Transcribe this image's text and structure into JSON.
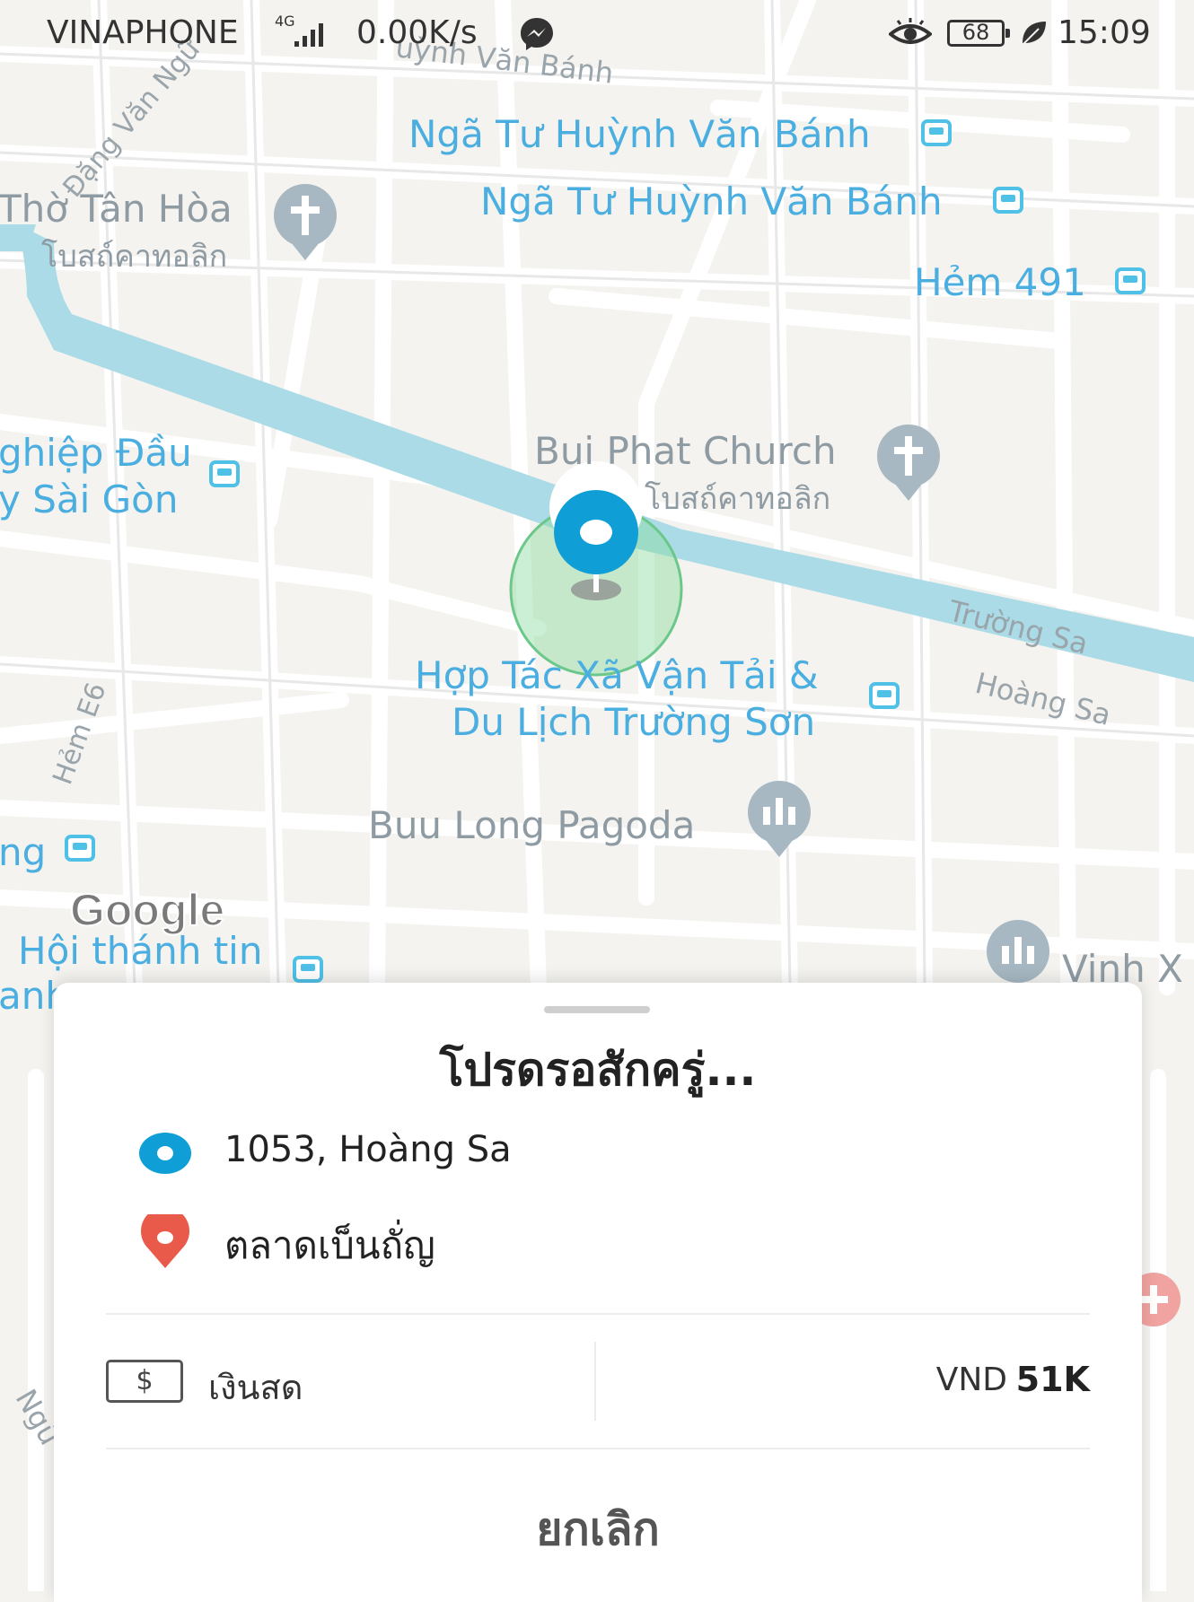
{
  "status_bar": {
    "carrier": "VINAPHONE",
    "network_type": "4G",
    "speed": "0.00K/s",
    "battery": "68",
    "time": "15:09"
  },
  "map": {
    "watermark": "Google",
    "places": {
      "bus_stop_1": "Ngã Tư Huỳnh Văn Bánh",
      "bus_stop_2": "Ngã Tư Huỳnh Văn Bánh",
      "bus_stop_3": "Hẻm 491",
      "church_1_name": "Thờ Tân Hòa",
      "church_1_type": "โบสถ์คาทอลิก",
      "church_2_name": "Bui Phat Church",
      "church_2_type": "โบสถ์คาทอลิก",
      "left_stop_line1": "ghiệp Đầu",
      "left_stop_line2": "y Sài Gòn",
      "coop_line1": "Hợp Tác Xã Vận Tải &",
      "coop_line2": "Du Lịch Trường Sơn",
      "pagoda": "Buu Long Pagoda",
      "left_ng": "ng",
      "hoi_thanh": "Hội thánh tin",
      "left_anh": "anh",
      "vinh": "Vinh X"
    },
    "streets": {
      "top": "uỳnh Văn Bánh",
      "dang_van_ngu": "Đặng Văn Ngữ",
      "truong_sa": "Trường Sa",
      "hoang_sa": "Hoàng Sa",
      "hem_e6": "Hẻm E6",
      "ngu": "Ngữ"
    }
  },
  "sheet": {
    "title": "โปรดรอสักครู่...",
    "pickup": "1053, Hoàng Sa",
    "destination": "ตลาดเบ็นถั่ญ",
    "payment_icon": "$",
    "payment_method": "เงินสด",
    "currency": "VND",
    "price": "51K",
    "cancel": "ยกเลิก"
  },
  "colors": {
    "canal": "#aadbe6",
    "accent_blue": "#0f9fd6",
    "destination_red": "#ea5a4a",
    "map_label_blue": "#4aaee0"
  }
}
